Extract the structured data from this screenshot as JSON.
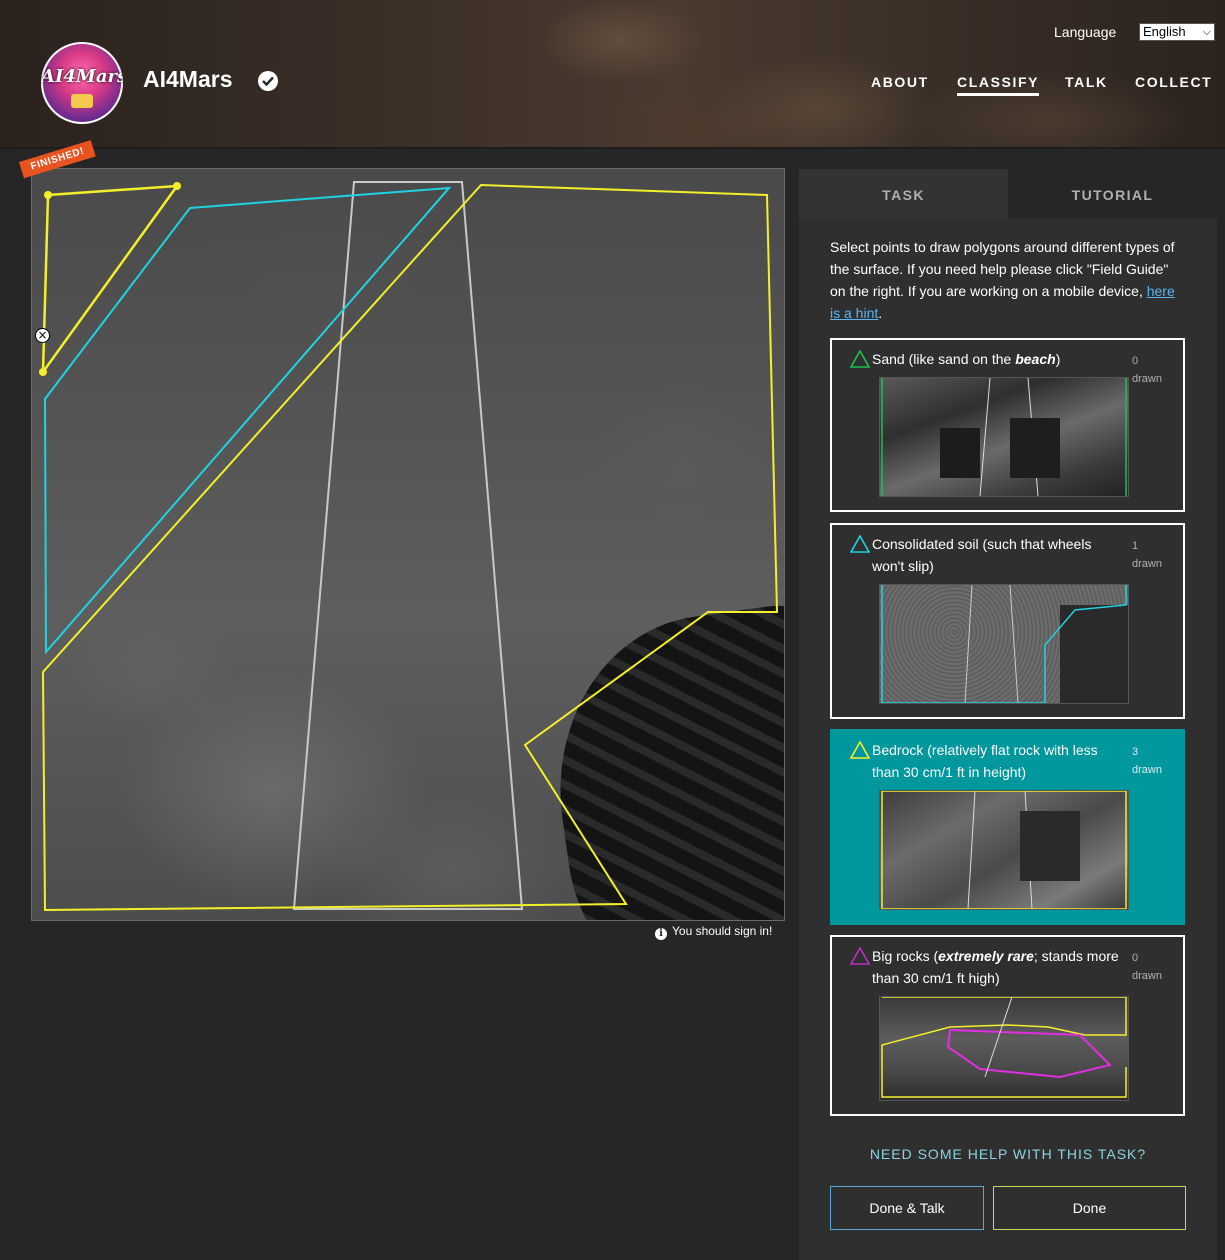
{
  "header": {
    "project_title": "AI4Mars",
    "avatar_text": "AI4Mars",
    "language_label": "Language",
    "language_selected": "English",
    "nav": [
      {
        "label": "ABOUT",
        "active": false
      },
      {
        "label": "CLASSIFY",
        "active": true
      },
      {
        "label": "TALK",
        "active": false
      },
      {
        "label": "COLLECT",
        "active": false
      }
    ]
  },
  "viewer": {
    "finished_badge": "FINISHED!",
    "sign_in_note": "You should sign in!",
    "colors": {
      "sand": "#00e676",
      "soil": "#1fd3e0",
      "bedrock": "#f3ef2a",
      "rocks": "#e02ee0",
      "guide": "#c8c8c8"
    }
  },
  "task_panel": {
    "tabs": {
      "task": "TASK",
      "tutorial": "TUTORIAL"
    },
    "instructions": {
      "text": "Select points to draw polygons around different types of the surface. If you need help please click \"Field Guide\" on the right. If you are working on a mobile device, ",
      "link": "here is a hint",
      "end": "."
    },
    "choices": [
      {
        "label_a": "Sand (like sand on the ",
        "label_em": "beach",
        "label_b": ")",
        "count": "0",
        "drawn": "drawn",
        "icon": "triangle-outline-icon",
        "color": "#19c24a",
        "active": false
      },
      {
        "label_a": "Consolidated soil (such that wheels won't slip)",
        "count": "1",
        "drawn": "drawn",
        "icon": "triangle-outline-icon",
        "color": "#1fd3e0",
        "active": false
      },
      {
        "label_a": "Bedrock (relatively flat rock with less than 30 cm/1 ft in height)",
        "count": "3",
        "drawn": "drawn",
        "icon": "triangle-outline-icon",
        "color": "#f3ef2a",
        "active": true
      },
      {
        "label_a": "Big rocks (",
        "label_em": "extremely rare",
        "label_b": "; stands more than 30 cm/1 ft high)",
        "count": "0",
        "drawn": "drawn",
        "icon": "triangle-outline-icon",
        "color": "#c02ec0",
        "active": false
      }
    ],
    "help_link": "NEED SOME HELP WITH THIS TASK?",
    "buttons": {
      "done_talk": "Done & Talk",
      "done": "Done"
    }
  }
}
